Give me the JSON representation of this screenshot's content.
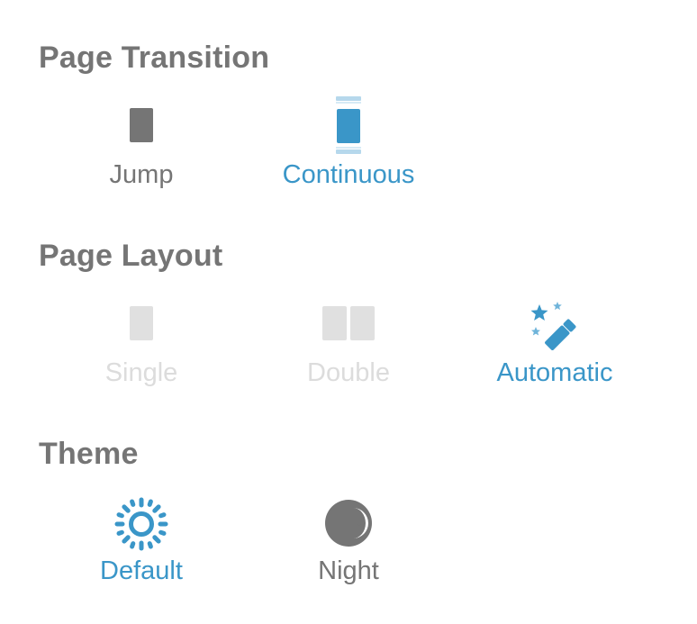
{
  "sections": {
    "page_transition": {
      "title": "Page Transition",
      "options": [
        {
          "label": "Jump",
          "icon": "single-page-icon",
          "state": "normal"
        },
        {
          "label": "Continuous",
          "icon": "continuous-scroll-icon",
          "state": "selected"
        }
      ]
    },
    "page_layout": {
      "title": "Page Layout",
      "options": [
        {
          "label": "Single",
          "icon": "single-page-icon",
          "state": "disabled"
        },
        {
          "label": "Double",
          "icon": "double-page-icon",
          "state": "disabled"
        },
        {
          "label": "Automatic",
          "icon": "magic-wand-icon",
          "state": "selected"
        }
      ]
    },
    "theme": {
      "title": "Theme",
      "options": [
        {
          "label": "Default",
          "icon": "sun-icon",
          "state": "selected"
        },
        {
          "label": "Night",
          "icon": "moon-icon",
          "state": "normal"
        }
      ]
    }
  },
  "colors": {
    "selected": "#3a96c8",
    "normal": "#757575",
    "disabled": "#dcdcdc",
    "title": "#757575",
    "background": "#ffffff"
  }
}
